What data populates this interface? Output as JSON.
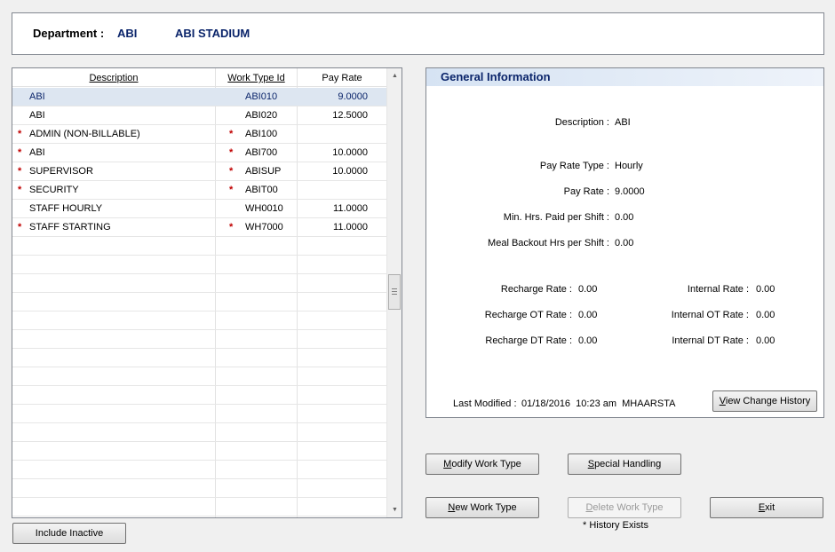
{
  "department": {
    "label": "Department :",
    "code": "ABI",
    "name": "ABI STADIUM"
  },
  "grid": {
    "headers": {
      "description": "Description",
      "work_type_id": "Work Type Id",
      "pay_rate": "Pay Rate"
    },
    "rows": [
      {
        "star": "",
        "description": "ABI",
        "wt_star": "",
        "work_type_id": "ABI010",
        "pay_rate": "9.0000"
      },
      {
        "star": "",
        "description": "ABI",
        "wt_star": "",
        "work_type_id": "ABI020",
        "pay_rate": "12.5000"
      },
      {
        "star": "*",
        "description": "ADMIN (NON-BILLABLE)",
        "wt_star": "*",
        "work_type_id": "ABI100",
        "pay_rate": ""
      },
      {
        "star": "*",
        "description": "ABI",
        "wt_star": "*",
        "work_type_id": "ABI700",
        "pay_rate": "10.0000"
      },
      {
        "star": "*",
        "description": "SUPERVISOR",
        "wt_star": "*",
        "work_type_id": "ABISUP",
        "pay_rate": "10.0000"
      },
      {
        "star": "*",
        "description": "SECURITY",
        "wt_star": "*",
        "work_type_id": "ABIT00",
        "pay_rate": ""
      },
      {
        "star": "",
        "description": "STAFF HOURLY",
        "wt_star": "",
        "work_type_id": "WH0010",
        "pay_rate": "11.0000"
      },
      {
        "star": "*",
        "description": "STAFF STARTING",
        "wt_star": "*",
        "work_type_id": "WH7000",
        "pay_rate": "11.0000"
      }
    ]
  },
  "general_info": {
    "title": "General Information",
    "description_label": "Description :",
    "description_value": "ABI",
    "pay_rate_type_label": "Pay Rate Type :",
    "pay_rate_type_value": "Hourly",
    "pay_rate_label": "Pay Rate :",
    "pay_rate_value": "9.0000",
    "min_hrs_label": "Min. Hrs. Paid per Shift :",
    "min_hrs_value": "0.00",
    "meal_backout_label": "Meal Backout Hrs per Shift :",
    "meal_backout_value": "0.00",
    "recharge_rate_label": "Recharge Rate :",
    "recharge_rate_value": "0.00",
    "recharge_ot_label": "Recharge OT Rate :",
    "recharge_ot_value": "0.00",
    "recharge_dt_label": "Recharge DT Rate :",
    "recharge_dt_value": "0.00",
    "internal_rate_label": "Internal Rate :",
    "internal_rate_value": "0.00",
    "internal_ot_label": "Internal OT Rate :",
    "internal_ot_value": "0.00",
    "internal_dt_label": "Internal DT Rate :",
    "internal_dt_value": "0.00",
    "last_modified_label": "Last Modified :",
    "last_modified_value": "01/18/2016  10:23 am  MHAARSTA"
  },
  "buttons": {
    "view_change_history": {
      "hot": "V",
      "rest": "iew Change History"
    },
    "modify_work_type": {
      "hot": "M",
      "rest": "odify Work Type"
    },
    "special_handling": {
      "hot": "S",
      "rest": "pecial Handling"
    },
    "new_work_type": {
      "hot": "N",
      "rest": "ew Work Type"
    },
    "delete_work_type": {
      "hot": "D",
      "rest": "elete Work Type"
    },
    "exit": {
      "hot": "E",
      "rest": "xit"
    },
    "include_inactive": "Include Inactive"
  },
  "history_note": "* History Exists",
  "colors": {
    "accent_text": "#0a246a",
    "required_star": "#c00000",
    "selection": "#dde6f1"
  }
}
